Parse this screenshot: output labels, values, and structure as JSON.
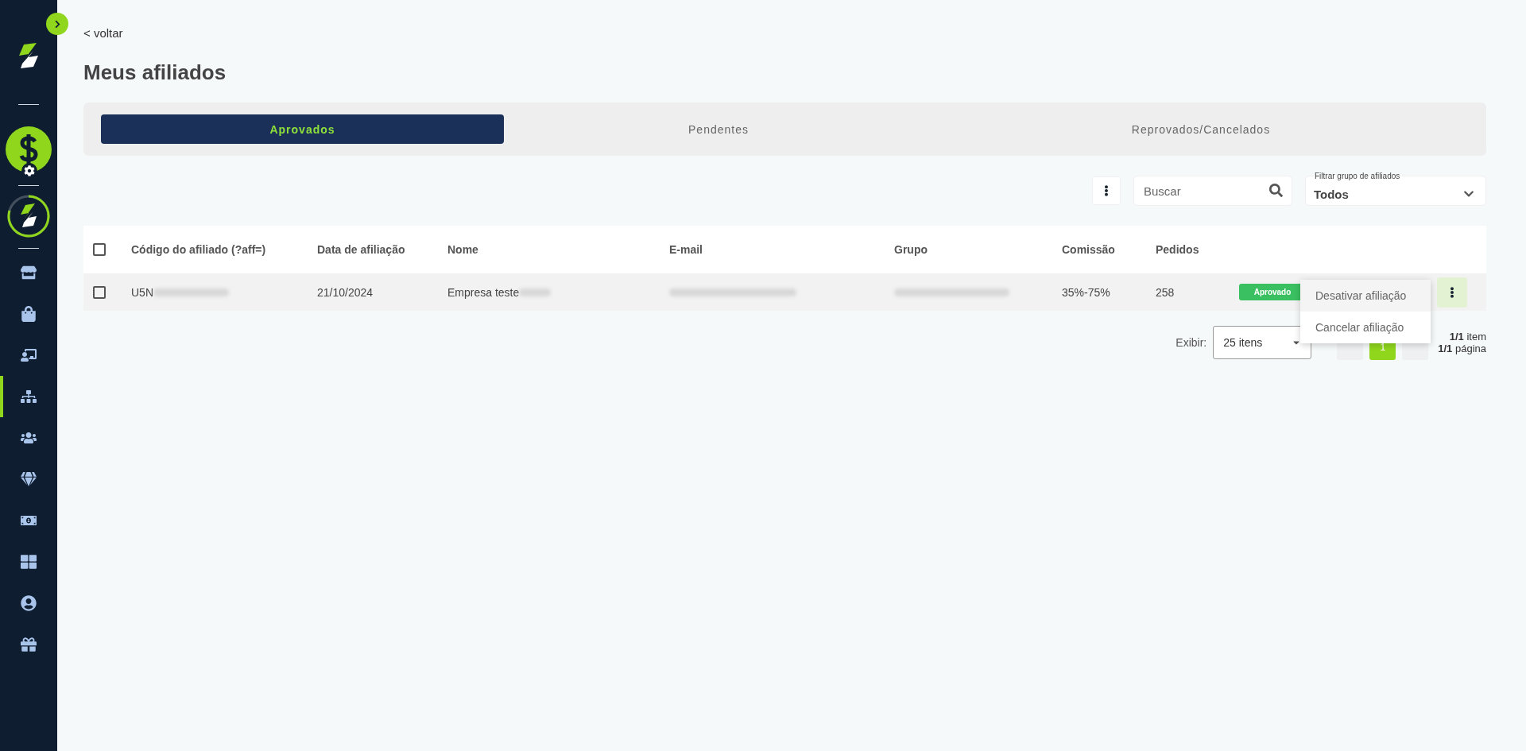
{
  "sidebar": {
    "nav_items": [
      {
        "selected": false
      },
      {
        "selected": false
      },
      {
        "selected": false
      },
      {
        "selected": true
      },
      {
        "selected": false
      },
      {
        "selected": false
      },
      {
        "selected": false
      },
      {
        "selected": false
      },
      {
        "selected": false
      },
      {
        "selected": false
      }
    ]
  },
  "back_link": "< voltar",
  "title": "Meus afiliados",
  "tabs": [
    {
      "label": "Aprovados",
      "selected": true
    },
    {
      "label": "Pendentes",
      "selected": false
    },
    {
      "label": "Reprovados/Cancelados",
      "selected": false
    }
  ],
  "toolbar": {
    "search": {
      "placeholder": "Buscar"
    },
    "group_filter": {
      "label": "Filtrar grupo de afiliados",
      "value": "Todos"
    }
  },
  "table": {
    "header_checked": false,
    "columns": [
      "Código do afiliado (?aff=)",
      "Data de afiliação",
      "Nome",
      "E-mail",
      "Grupo",
      "Comissão",
      "Pedidos"
    ],
    "rows": [
      {
        "checked": false,
        "code": "U5N",
        "date": "21/10/2024",
        "name": "Empresa teste",
        "commission": "35%-75%",
        "orders": "258",
        "status": "Aprovado"
      }
    ]
  },
  "row_menu": {
    "items": [
      "Desativar afiliação",
      "Cancelar afiliação"
    ]
  },
  "pagination": {
    "label": "Exibir:",
    "page_size": "25 itens",
    "pages": [
      {
        "label": "1",
        "selected": true
      }
    ],
    "item_count": "**1/1** item",
    "page_count": "**1/1** página"
  }
}
